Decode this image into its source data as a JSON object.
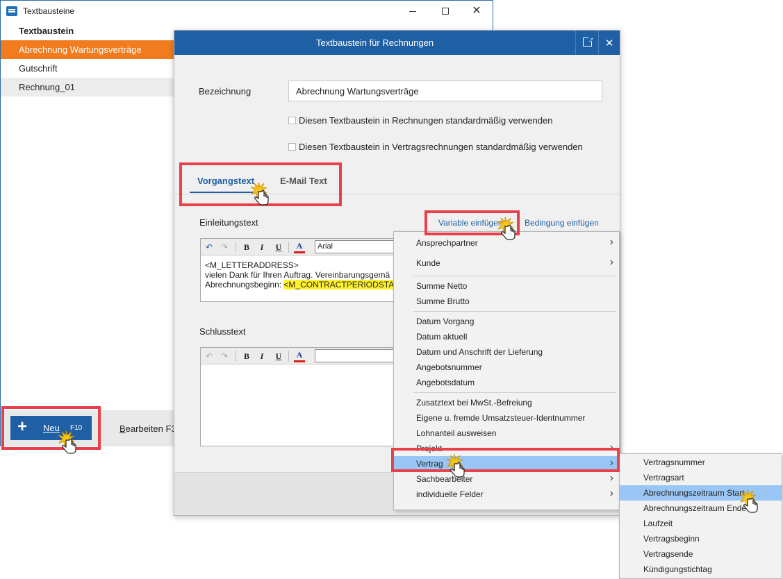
{
  "main_window": {
    "title": "Textbausteine",
    "list_header": "Textbaustein",
    "items": [
      {
        "label": "Abrechnung Wartungsverträge",
        "selected": true
      },
      {
        "label": "Gutschrift",
        "selected": false
      },
      {
        "label": "Rechnung_01",
        "selected": false
      }
    ],
    "new_button": {
      "label": "Neu",
      "shortcut": "F10",
      "icon": "plus-icon"
    },
    "edit_button": {
      "label_underlined": "B",
      "label_rest": "earbeiten F3"
    },
    "colors": {
      "selected_row": "#f07c1f",
      "primary": "#1f5fa3"
    }
  },
  "dialog": {
    "title": "Textbaustein für Rechnungen",
    "bezeichnung_label": "Bezeichnung",
    "bezeichnung_value": "Abrechnung Wartungsverträge",
    "checkbox_1": "Diesen Textbaustein in Rechnungen standardmäßig verwenden",
    "checkbox_2": "Diesen Textbaustein in Vertragsrechnungen standardmäßig verwenden",
    "tabs": [
      {
        "label": "Vorgangstext",
        "active": true
      },
      {
        "label": "E-Mail Text",
        "active": false
      }
    ],
    "einleitung_label": "Einleitungstext",
    "variable_link": "Variable einfügen",
    "bedingung_link": "Bedingung einfügen",
    "editor_font": "Arial",
    "einleitung_lines": [
      "<M_LETTERADDRESS>",
      "vielen Dank für Ihren Auftrag. Vereinbarungsgemä",
      "Abrechnungsbeginn: "
    ],
    "einleitung_highlight": "<M_CONTRACTPERIODSTA",
    "schluss_label": "Schlusstext"
  },
  "context_menu": {
    "groups": [
      [
        {
          "label": "Ansprechpartner",
          "submenu": true
        },
        {
          "label": "Kunde",
          "submenu": true
        }
      ],
      [
        {
          "label": "Summe Netto",
          "submenu": false
        },
        {
          "label": "Summe Brutto",
          "submenu": false
        }
      ],
      [
        {
          "label": "Datum Vorgang",
          "submenu": false
        },
        {
          "label": "Datum aktuell",
          "submenu": false
        },
        {
          "label": "Datum und Anschrift der Lieferung",
          "submenu": false
        },
        {
          "label": "Angebotsnummer",
          "submenu": false
        },
        {
          "label": "Angebotsdatum",
          "submenu": false
        }
      ],
      [
        {
          "label": "Zusatztext bei MwSt.-Befreiung",
          "submenu": false
        },
        {
          "label": "Eigene u. fremde Umsatzsteuer-Identnummer",
          "submenu": false
        },
        {
          "label": "Lohnanteil ausweisen",
          "submenu": false
        },
        {
          "label": "Projekt",
          "submenu": true
        },
        {
          "label": "Vertrag",
          "submenu": true,
          "active": true
        },
        {
          "label": "Sachbearbeiter",
          "submenu": true
        },
        {
          "label": "individuelle Felder",
          "submenu": true
        }
      ]
    ]
  },
  "sub_menu": {
    "items": [
      {
        "label": "Vertragsnummer"
      },
      {
        "label": "Vertragsart"
      },
      {
        "label": "Abrechnungszeitraum Start",
        "active": true
      },
      {
        "label": "Abrechnungszeitraum Ende"
      },
      {
        "label": "Laufzeit"
      },
      {
        "label": "Vertragsbeginn"
      },
      {
        "label": "Vertragsende"
      },
      {
        "label": "Kündigungstichtag"
      }
    ],
    "highlight_color": "#99c6f5"
  },
  "annotations": {
    "highlight_color": "#e8414b"
  }
}
